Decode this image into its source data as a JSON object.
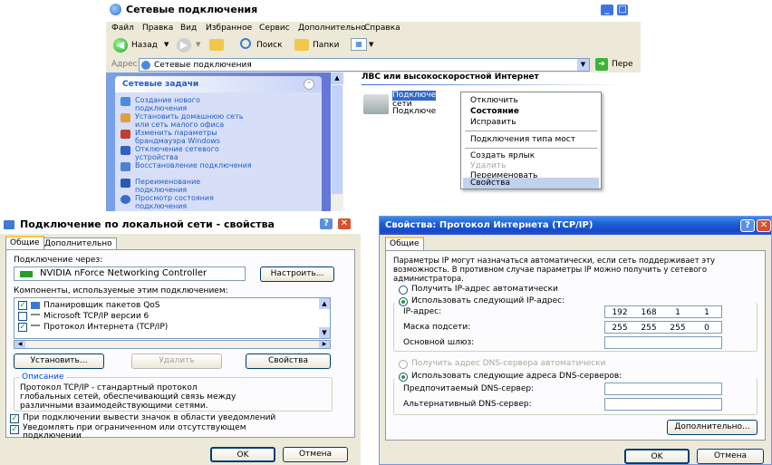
{
  "explorer": {
    "title": "Сетевые подключения",
    "menu": [
      "Файл",
      "Правка",
      "Вид",
      "Избранное",
      "Сервис",
      "Дополнительно",
      "Справка"
    ],
    "toolbar": {
      "back": "Назад",
      "search": "Поиск",
      "folders": "Папки"
    },
    "address_label": "Адрес:",
    "address_value": "Сетевые подключения",
    "go_label": "Пере",
    "tasks_header": "Сетевые задачи",
    "tasks": [
      "Создание нового подключения",
      "Установить домашнюю сеть или сеть малого офиса",
      "Изменить параметры брандмауэра Windows",
      "Отключение сетевого устройства",
      "Восстановление подключения",
      "Переименование подключения",
      "Просмотр состояния подключения"
    ],
    "group_title": "ЛВС или высокоскоростной Интернет",
    "connection_text": [
      "Подключе",
      "сети",
      "Подключе"
    ],
    "context_menu": [
      "Отключить",
      "Состояние",
      "Исправить",
      "Подключения типа мост",
      "Создать ярлык",
      "Удалить",
      "Переименовать",
      "Свойства"
    ]
  },
  "lan_props": {
    "title": "Подключение по локальной сети - свойства",
    "tabs": [
      "Общие",
      "Дополнительно"
    ],
    "connect_via_label": "Подключение через:",
    "adapter": "NVIDIA nForce Networking Controller",
    "configure_button": "Настроить...",
    "components_label": "Компоненты, используемые этим подключением:",
    "components": [
      {
        "name": "Планировщик пакетов QoS",
        "checked": true
      },
      {
        "name": "Microsoft TCP/IP версии 6",
        "checked": false
      },
      {
        "name": "Протокол Интернета (TCP/IP)",
        "checked": true
      }
    ],
    "install_button": "Установить...",
    "remove_button": "Удалить",
    "properties_button": "Свойства",
    "description_label": "Описание",
    "description_text": "Протокол TCP/IP - стандартный протокол глобальных сетей, обеспечивающий связь между различными взаимодействующими сетями.",
    "show_icon_label": "При подключении вывести значок в области уведомлений",
    "notify_label": "Уведомлять при ограниченном или отсутствующем подключении",
    "ok_button": "OK",
    "cancel_button": "Отмена"
  },
  "tcpip_props": {
    "title": "Свойства: Протокол Интернета (TCP/IP)",
    "tab": "Общие",
    "intro": "Параметры IP могут назначаться автоматически, если сеть поддерживает эту возможность. В противном случае параметры IP можно получить у сетевого администратора.",
    "auto_ip_label": "Получить IP-адрес автоматически",
    "manual_ip_label": "Использовать следующий IP-адрес:",
    "ip_label": "IP-адрес:",
    "ip_value": [
      "192",
      "168",
      "1",
      "1"
    ],
    "mask_label": "Маска подсети:",
    "mask_value": [
      "255",
      "255",
      "255",
      "0"
    ],
    "gateway_label": "Основной шлюз:",
    "auto_dns_label": "Получить адрес DNS-сервера автоматически",
    "manual_dns_label": "Использовать следующие адреса DNS-серверов:",
    "pref_dns_label": "Предпочитаемый DNS-сервер:",
    "alt_dns_label": "Альтернативный DNS-сервер:",
    "advanced_button": "Дополнительно...",
    "ok_button": "OK",
    "cancel_button": "Отмена"
  }
}
